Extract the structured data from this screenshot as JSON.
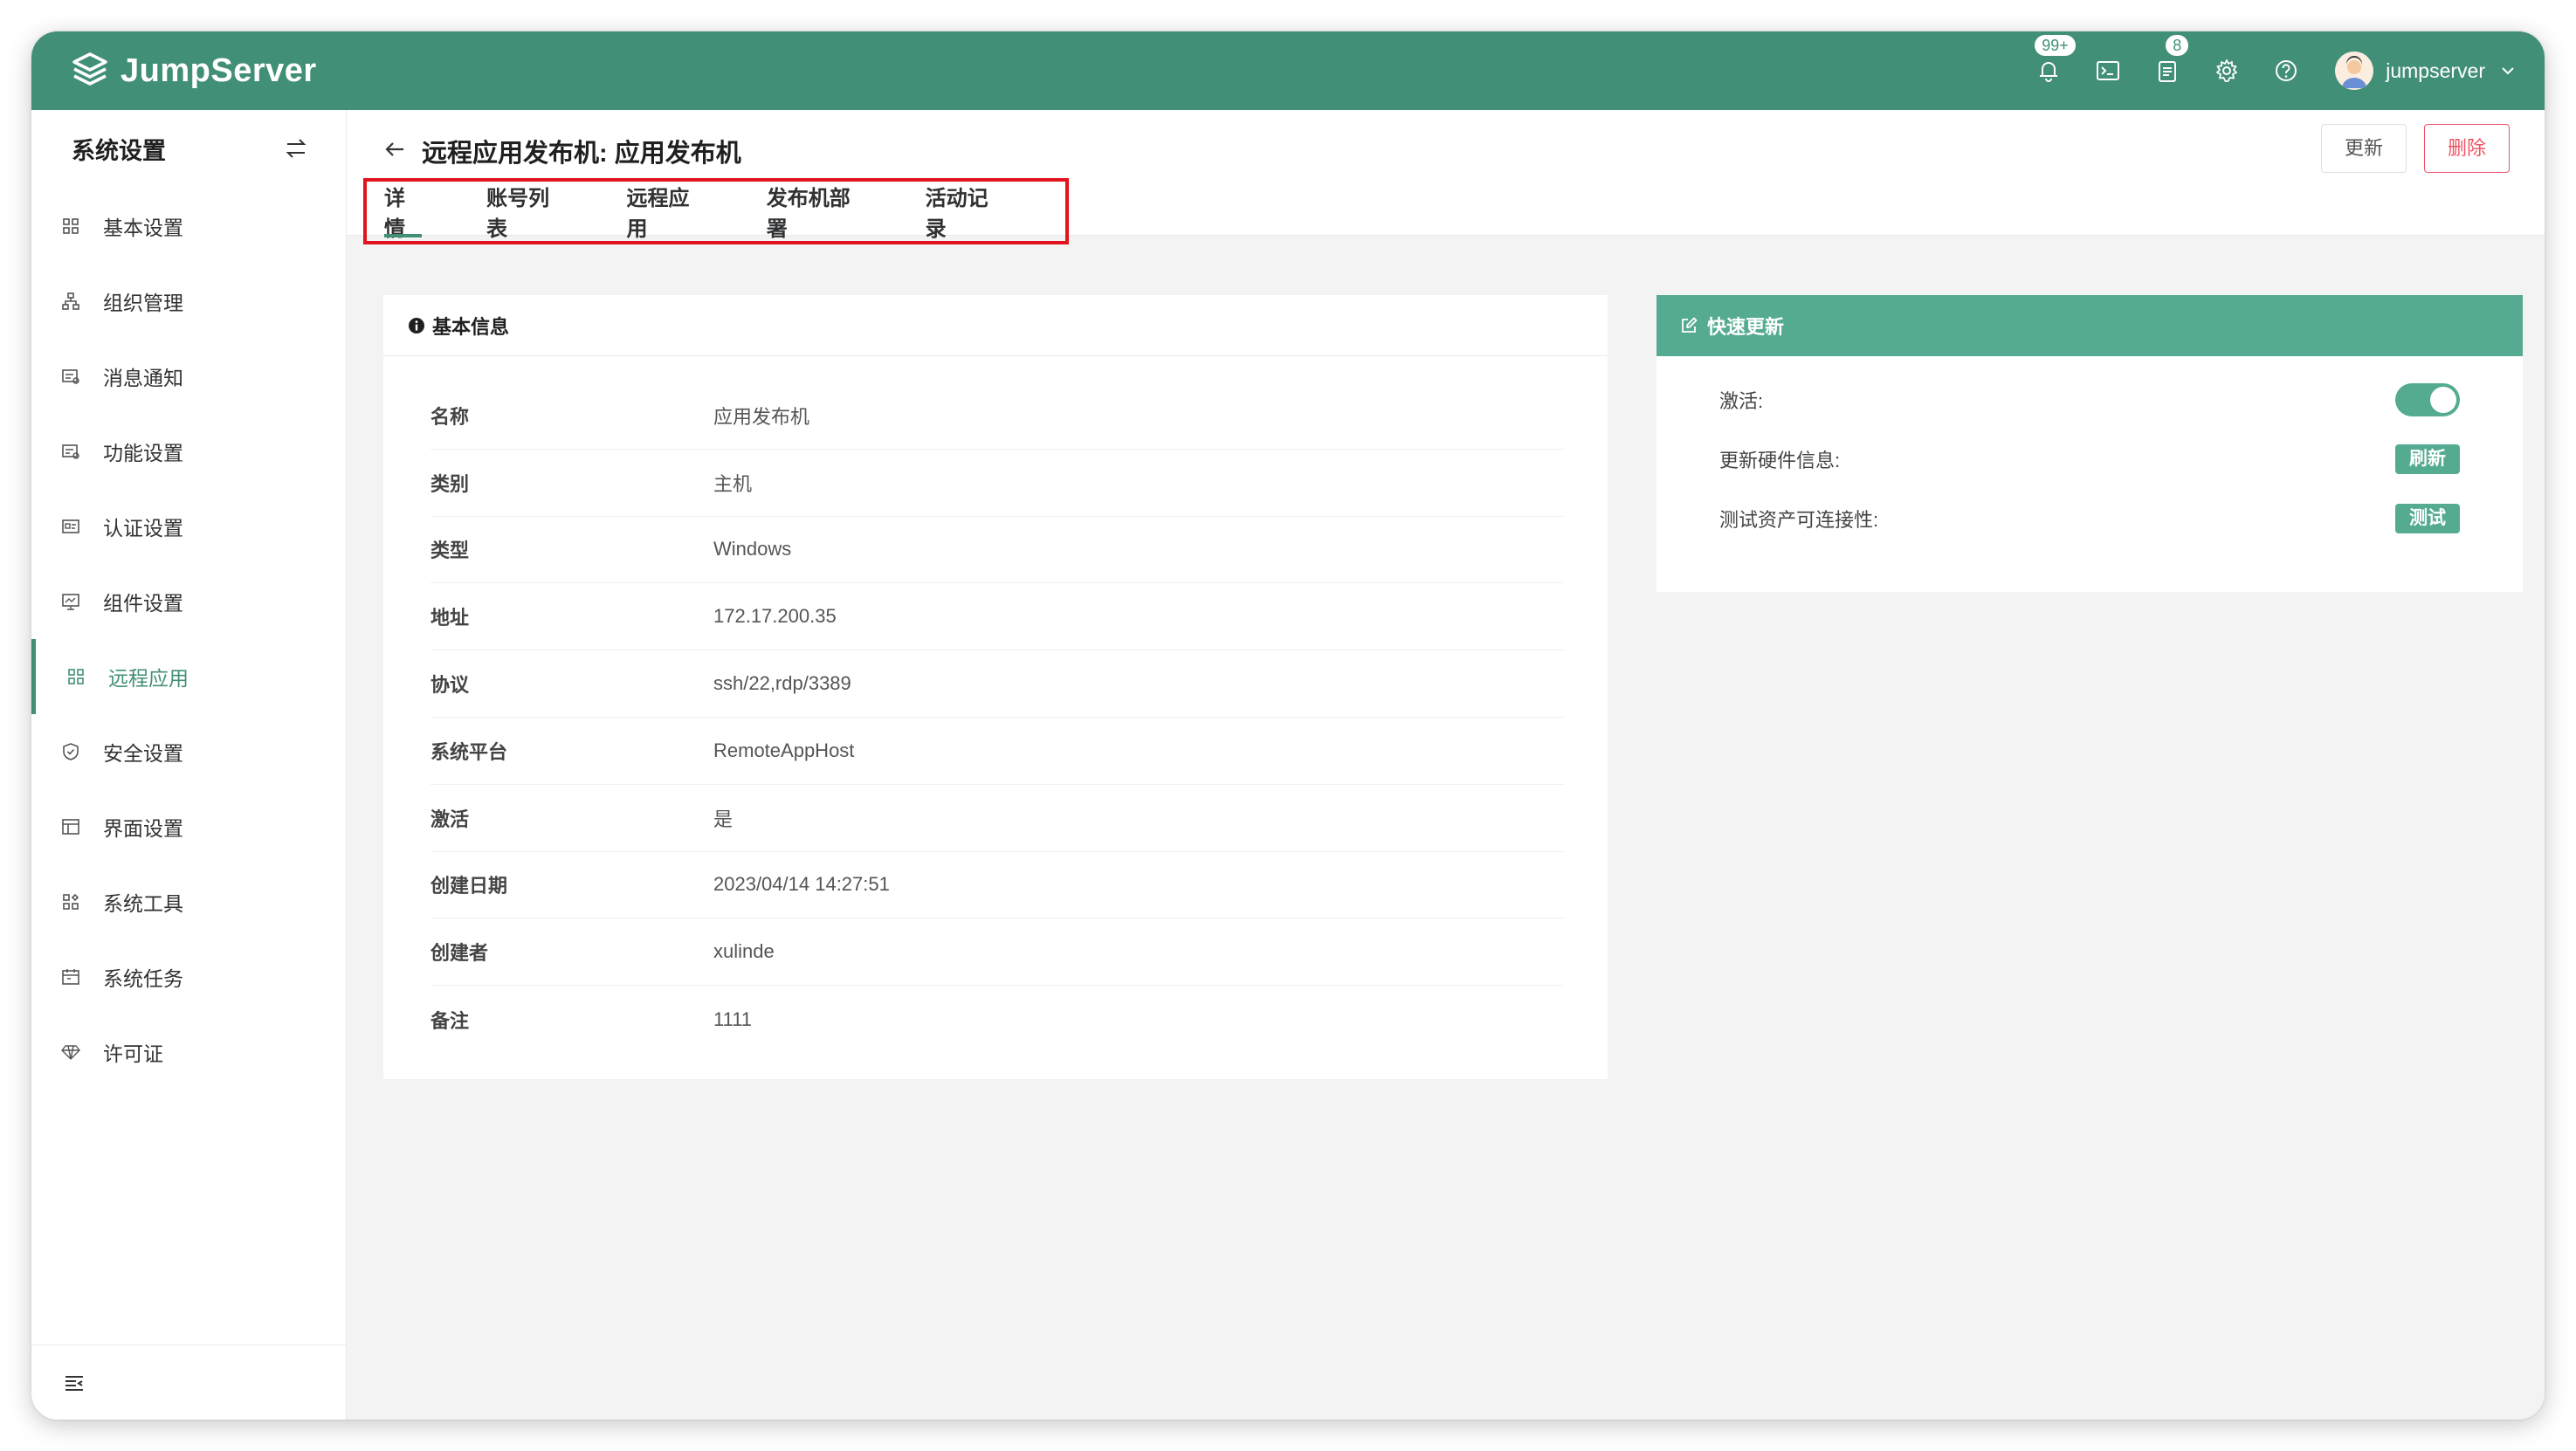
{
  "brand": {
    "name": "JumpServer"
  },
  "topbar": {
    "notifications_badge": "99+",
    "tickets_badge": "8",
    "username": "jumpserver"
  },
  "sidebar": {
    "title": "系统设置",
    "items": [
      {
        "label": "基本设置",
        "icon": "grid-icon"
      },
      {
        "label": "组织管理",
        "icon": "org-tree-icon"
      },
      {
        "label": "消息通知",
        "icon": "message-icon"
      },
      {
        "label": "功能设置",
        "icon": "feature-icon"
      },
      {
        "label": "认证设置",
        "icon": "id-card-icon"
      },
      {
        "label": "组件设置",
        "icon": "monitor-icon"
      },
      {
        "label": "远程应用",
        "icon": "apps-icon",
        "active": true
      },
      {
        "label": "安全设置",
        "icon": "shield-icon"
      },
      {
        "label": "界面设置",
        "icon": "layout-icon"
      },
      {
        "label": "系统工具",
        "icon": "tools-icon"
      },
      {
        "label": "系统任务",
        "icon": "calendar-icon"
      },
      {
        "label": "许可证",
        "icon": "diamond-icon"
      }
    ]
  },
  "page": {
    "title": "远程应用发布机: 应用发布机",
    "update_label": "更新",
    "delete_label": "删除",
    "tabs": [
      {
        "label": "详情",
        "active": true
      },
      {
        "label": "账号列表"
      },
      {
        "label": "远程应用"
      },
      {
        "label": "发布机部署"
      },
      {
        "label": "活动记录"
      }
    ]
  },
  "basic_info": {
    "title": "基本信息",
    "rows": [
      {
        "label": "名称",
        "value": "应用发布机"
      },
      {
        "label": "类别",
        "value": "主机"
      },
      {
        "label": "类型",
        "value": "Windows"
      },
      {
        "label": "地址",
        "value": "172.17.200.35"
      },
      {
        "label": "协议",
        "value": "ssh/22,rdp/3389"
      },
      {
        "label": "系统平台",
        "value": "RemoteAppHost"
      },
      {
        "label": "激活",
        "value": "是"
      },
      {
        "label": "创建日期",
        "value": "2023/04/14 14:27:51"
      },
      {
        "label": "创建者",
        "value": "xulinde"
      },
      {
        "label": "备注",
        "value": "1111"
      }
    ]
  },
  "quick_update": {
    "title": "快速更新",
    "active_label": "激活:",
    "active_on": true,
    "hardware_label": "更新硬件信息:",
    "hardware_button": "刷新",
    "test_label": "测试资产可连接性:",
    "test_button": "测试"
  },
  "colors": {
    "brand": "#428f78",
    "accent": "#55ab91",
    "danger": "#ed5565",
    "highlight_box": "#e3131e"
  }
}
